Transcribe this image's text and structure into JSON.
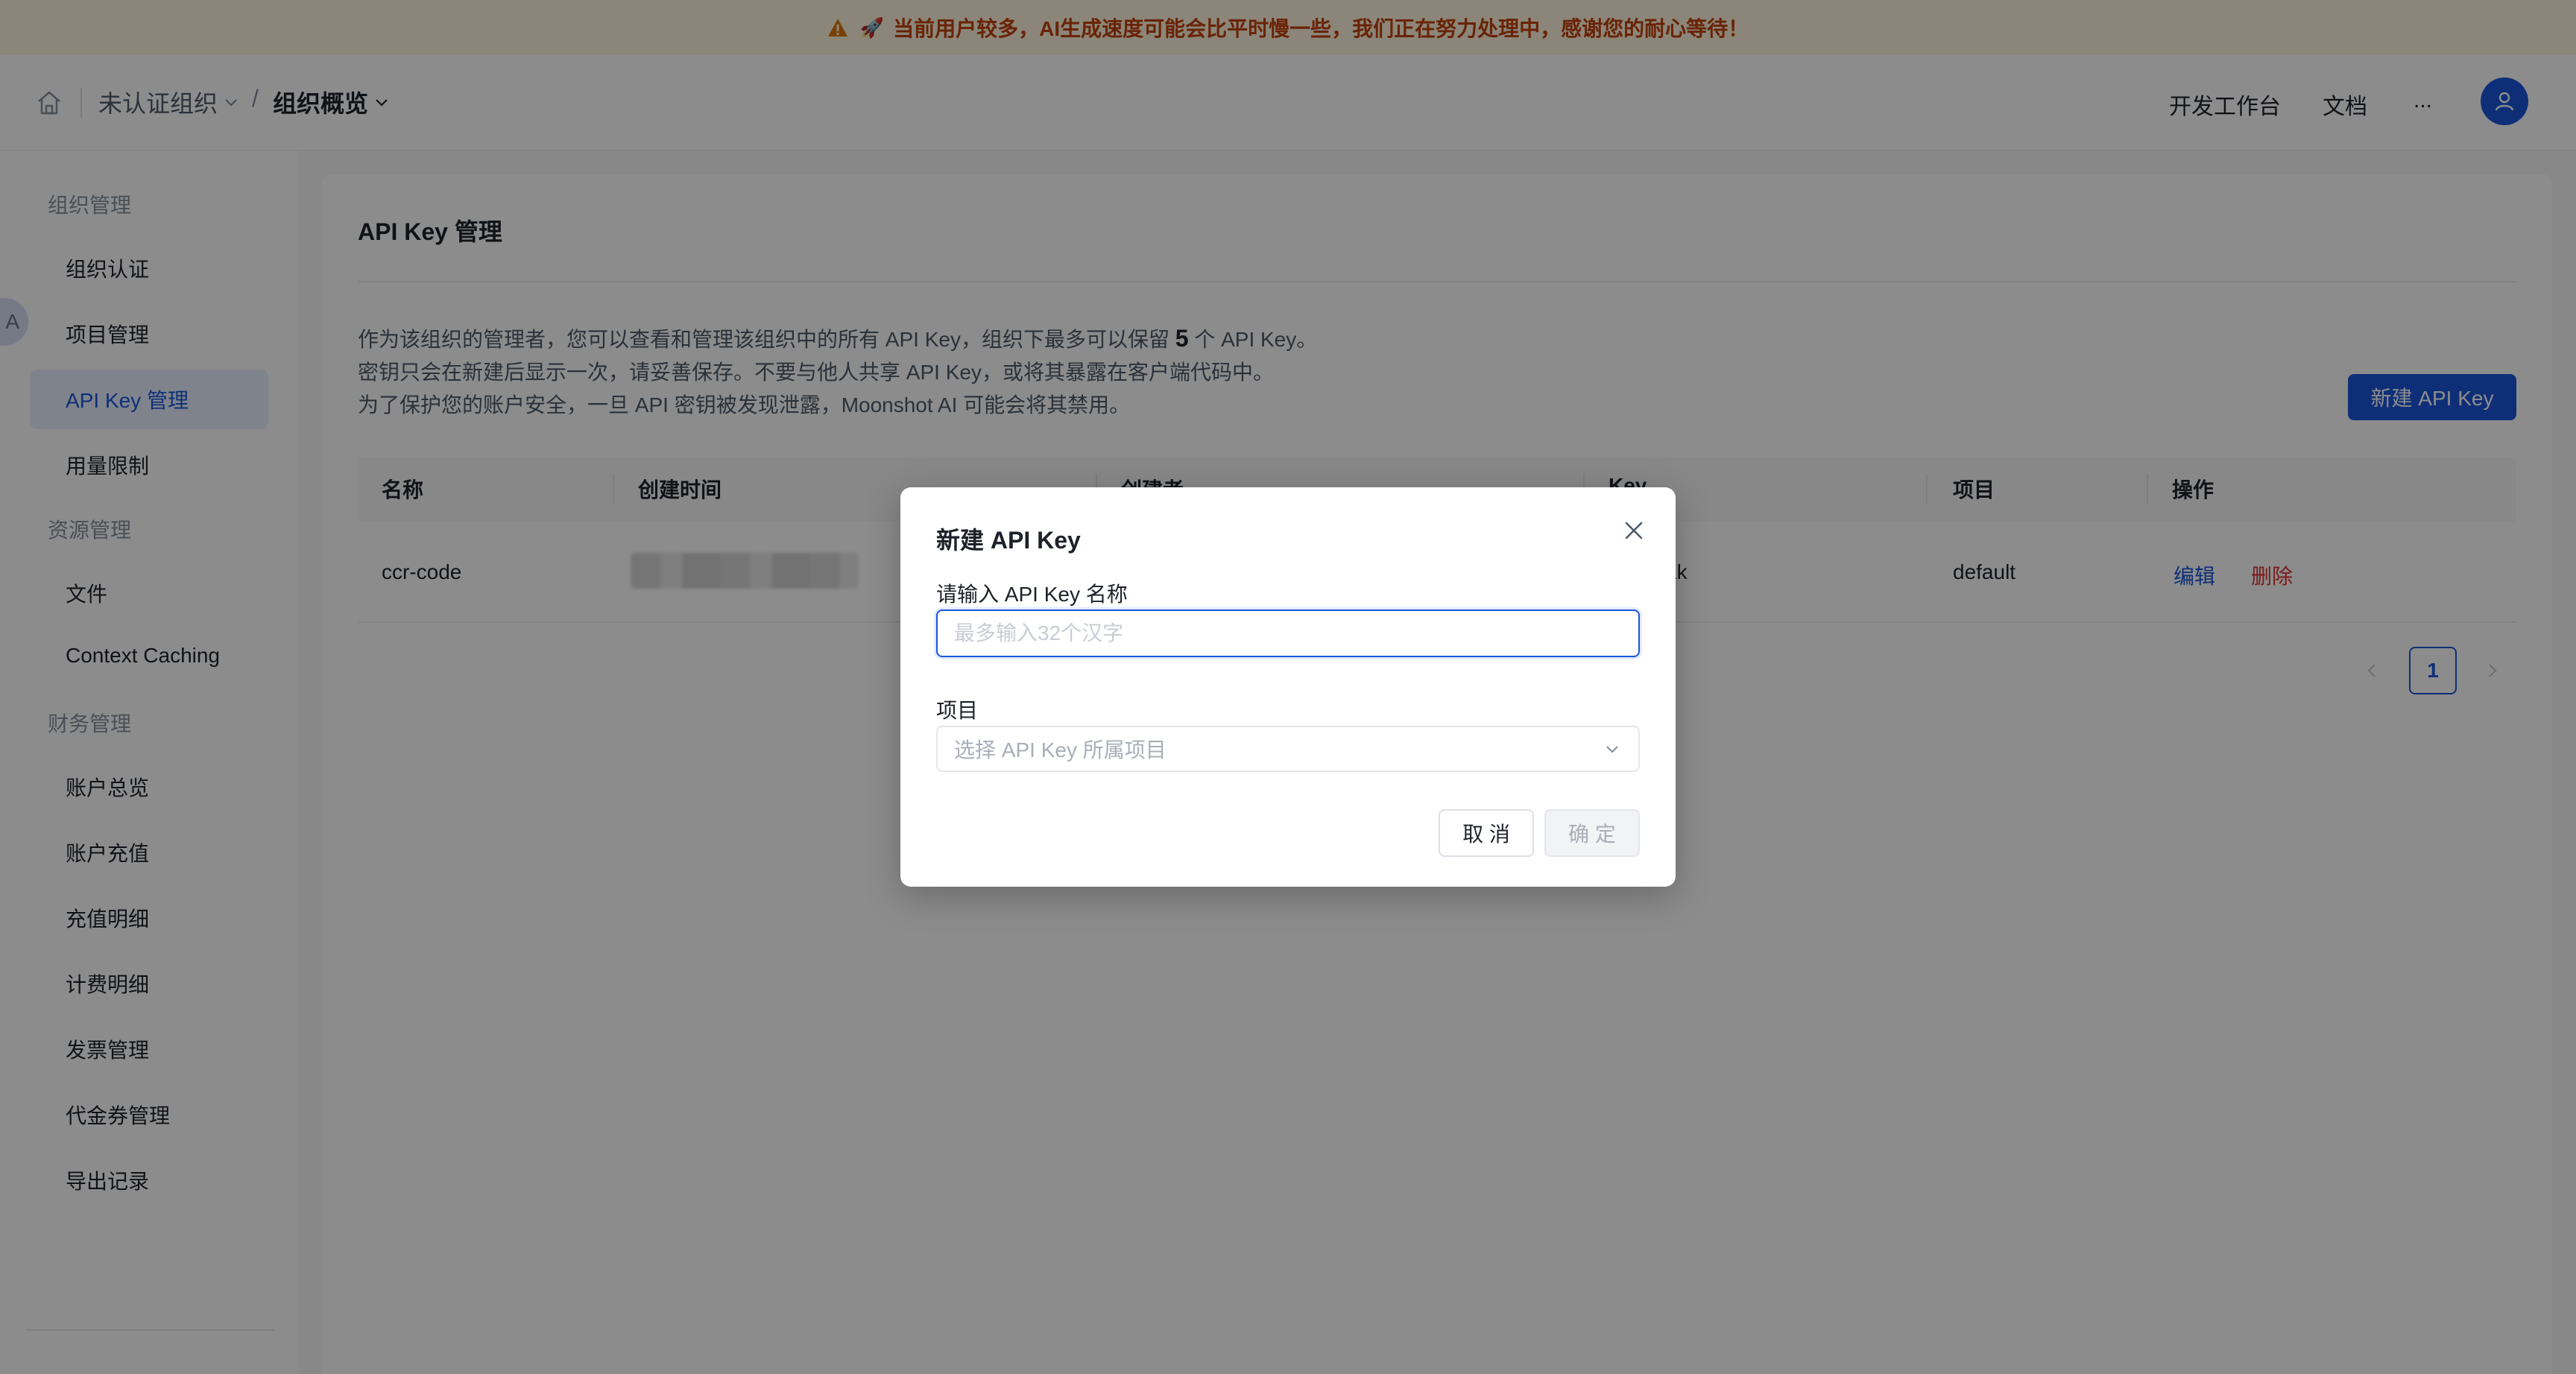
{
  "banner": {
    "rocket": "🚀",
    "text": "当前用户较多，AI生成速度可能会比平时慢一些，我们正在努力处理中，感谢您的耐心等待！"
  },
  "header": {
    "org_label": "未认证组织",
    "separator": "/",
    "current_page": "组织概览",
    "links": [
      "开发工作台",
      "文档",
      "..."
    ]
  },
  "sidebar": {
    "avatar_peek_letter": "A",
    "sections": [
      {
        "title": "组织管理",
        "items": [
          "组织认证",
          "项目管理",
          "API Key 管理",
          "用量限制"
        ]
      },
      {
        "title": "资源管理",
        "items": [
          "文件",
          "Context Caching"
        ]
      },
      {
        "title": "财务管理",
        "items": [
          "账户总览",
          "账户充值",
          "充值明细",
          "计费明细",
          "发票管理",
          "代金券管理",
          "导出记录"
        ]
      }
    ],
    "active_item": "API Key 管理"
  },
  "main": {
    "title": "API Key 管理",
    "desc_line1_pre": "作为该组织的管理者，您可以查看和管理该组织中的所有 API Key，组织下最多可以保留",
    "desc_line1_num": "5",
    "desc_line1_post": "个 API Key。",
    "desc_line2": "密钥只会在新建后显示一次，请妥善保存。不要与他人共享 API Key，或将其暴露在客户端代码中。",
    "desc_line3": "为了保护您的账户安全，一旦 API 密钥被发现泄露，Moonshot AI 可能会将其禁用。",
    "new_button": "新建 API Key",
    "table": {
      "columns": [
        "名称",
        "创建时间",
        "创建者",
        "Key",
        "项目",
        "操作"
      ],
      "rows": [
        {
          "name": "ccr-code",
          "created": "",
          "creator": "",
          "key": "...u3cZk",
          "project": "default",
          "edit": "编辑",
          "delete": "删除"
        }
      ]
    },
    "pagination": {
      "current": "1"
    }
  },
  "modal": {
    "title": "新建 API Key",
    "name_label": "请输入 API Key 名称",
    "name_placeholder": "最多输入32个汉字",
    "name_value": "",
    "project_label": "项目",
    "project_placeholder": "选择 API Key 所属项目",
    "cancel": "取 消",
    "ok": "确 定"
  },
  "colors": {
    "primary": "#1a56db",
    "danger": "#e03131",
    "banner_bg": "#fdf4dc",
    "banner_text": "#c2410c"
  },
  "icons": [
    "warning-icon",
    "home-icon",
    "chevron-down-icon",
    "user-icon",
    "close-icon",
    "chevron-left-icon",
    "chevron-right-icon"
  ]
}
